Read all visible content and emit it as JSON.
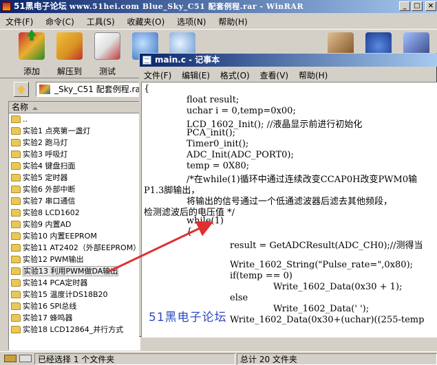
{
  "winrar": {
    "title_main": "51黑电子论坛",
    "title_sub": "www.51hei.com Blue_Sky_C51 配套例程.rar - WinRAR",
    "window_controls": {
      "minimize": "_",
      "maximize": "□",
      "close": "×"
    },
    "menu": [
      "文件(F)",
      "命令(C)",
      "工具(S)",
      "收藏夹(O)",
      "选项(N)",
      "帮助(H)"
    ],
    "toolbar": [
      {
        "label": "添加",
        "icon": "add-archive-icon"
      },
      {
        "label": "解压到",
        "icon": "extract-icon"
      },
      {
        "label": "测试",
        "icon": "test-icon"
      }
    ],
    "address": "_Sky_C51 配套例程.ra",
    "file_list": {
      "column_name": "名称",
      "items": [
        "..",
        "实验1 点亮第一盏灯",
        "实验2 跑马灯",
        "实验3 呼吸灯",
        "实验4 键盘扫面",
        "实验5 定时器",
        "实验6 外部中断",
        "实验7 串口通信",
        "实验8 LCD1602",
        "实验9 内置AD",
        "实验10 内置EEPROM",
        "实验11 AT2402（外部EEPROM）",
        "实验12 PWM输出",
        "实验13 利用PWM做DA输出",
        "实验14 PCA定时器",
        "实验15 温度计DS18B20",
        "实验16 SPI总线",
        "实验17 蜂鸣器",
        "实验18 LCD12864_并行方式"
      ],
      "selected_index": 13
    },
    "status": {
      "left": "已经选择 1 个文件夹",
      "right": "总计 20 文件夹"
    }
  },
  "notepad": {
    "title": "main.c - 记事本",
    "menu": [
      "文件(F)",
      "编辑(E)",
      "格式(O)",
      "查看(V)",
      "帮助(H)"
    ],
    "code_lines": [
      {
        "indent": 0,
        "text": "{"
      },
      {
        "indent": 1,
        "text": "float result;"
      },
      {
        "indent": 1,
        "text": "uchar i = 0,temp=0x00;"
      },
      {
        "indent": 1,
        "text": "LCD_1602_Init(); //液晶显示前进行初始化"
      },
      {
        "indent": 1,
        "text": "PCA_init();"
      },
      {
        "indent": 1,
        "text": "Timer0_init();"
      },
      {
        "indent": 1,
        "text": "ADC_Init(ADC_PORT0);"
      },
      {
        "indent": 1,
        "text": "temp = 0X80;"
      },
      {
        "indent": 1,
        "text": "/*在while(1)循环中通过连续改变CCAP0H改变PWM0输"
      },
      {
        "indent": 0,
        "text": "P1.3脚输出，"
      },
      {
        "indent": 1,
        "text": "将输出的信号通过一个低通滤波器后滤去其他频段，"
      },
      {
        "indent": 0,
        "text": "检测滤波后的电压值 */"
      },
      {
        "indent": 1,
        "text": "while(1)"
      },
      {
        "indent": 1,
        "text": "{"
      },
      {
        "indent": 2,
        "text": "result = GetADCResult(ADC_CH0);//测得当"
      },
      {
        "indent": 2,
        "text": ""
      },
      {
        "indent": 2,
        "text": "Write_1602_String(\"Pulse_rate=\",0x80);"
      },
      {
        "indent": 2,
        "text": "if(temp == 0)"
      },
      {
        "indent": 3,
        "text": "Write_1602_Data(0x30 + 1);"
      },
      {
        "indent": 2,
        "text": "else"
      },
      {
        "indent": 3,
        "text": "Write_1602_Data(' ');"
      },
      {
        "indent": 2,
        "text": "Write_1602_Data(0x30+(uchar)((255-temp"
      }
    ]
  },
  "watermark": "51黑电子论坛"
}
